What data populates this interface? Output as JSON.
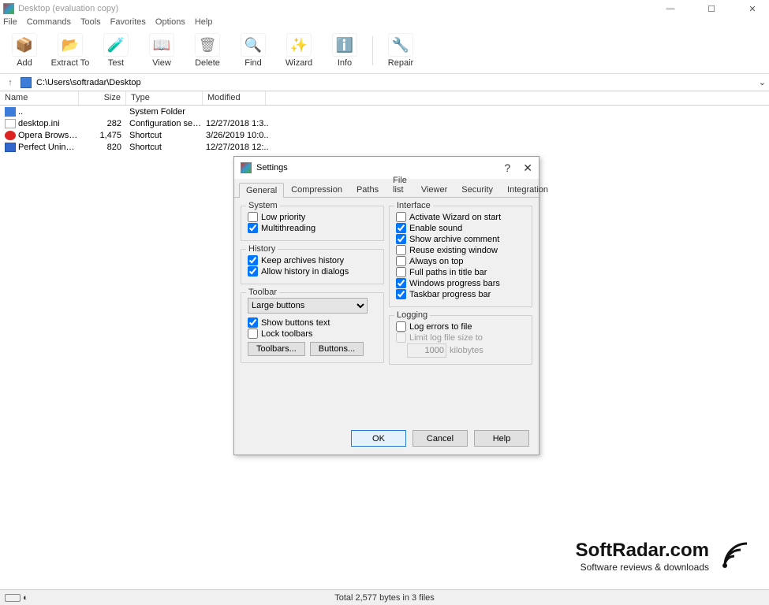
{
  "window": {
    "title": "Desktop (evaluation copy)"
  },
  "menu": [
    "File",
    "Commands",
    "Tools",
    "Favorites",
    "Options",
    "Help"
  ],
  "toolbar": [
    {
      "label": "Add",
      "icon": "📦",
      "color": "#c66"
    },
    {
      "label": "Extract To",
      "icon": "📂",
      "color": "#3a7bd5"
    },
    {
      "label": "Test",
      "icon": "🧪",
      "color": "#3ab54a"
    },
    {
      "label": "View",
      "icon": "📖",
      "color": "#b33"
    },
    {
      "label": "Delete",
      "icon": "🗑",
      "color": "#888"
    },
    {
      "label": "Find",
      "icon": "🔍",
      "color": "#d9902a"
    },
    {
      "label": "Wizard",
      "icon": "✨",
      "color": "#3ab54a"
    },
    {
      "label": "Info",
      "icon": "ℹ️",
      "color": "#2a7bd0"
    },
    {
      "label": "Repair",
      "icon": "🔧",
      "color": "#3a8a3a"
    }
  ],
  "path": "C:\\Users\\softradar\\Desktop",
  "columns": {
    "name": "Name",
    "size": "Size",
    "type": "Type",
    "modified": "Modified"
  },
  "files": [
    {
      "icon": "folder",
      "name": "..",
      "size": "",
      "type": "System Folder",
      "modified": ""
    },
    {
      "icon": "ini",
      "name": "desktop.ini",
      "size": "282",
      "type": "Configuration setti..",
      "modified": "12/27/2018 1:3.."
    },
    {
      "icon": "opera",
      "name": "Opera Browser.lnk",
      "size": "1,475",
      "type": "Shortcut",
      "modified": "3/26/2019 10:0.."
    },
    {
      "icon": "app",
      "name": "Perfect Uninstall...",
      "size": "820",
      "type": "Shortcut",
      "modified": "12/27/2018 12:.."
    }
  ],
  "settings": {
    "title": "Settings",
    "tabs": [
      "General",
      "Compression",
      "Paths",
      "File list",
      "Viewer",
      "Security",
      "Integration"
    ],
    "activeTab": 0,
    "system": {
      "legend": "System",
      "low_priority": "Low priority",
      "multithreading": "Multithreading"
    },
    "history": {
      "legend": "History",
      "keep": "Keep archives history",
      "allow": "Allow history in dialogs"
    },
    "toolbar": {
      "legend": "Toolbar",
      "select": "Large buttons",
      "show_text": "Show buttons text",
      "lock": "Lock toolbars",
      "btn_toolbars": "Toolbars...",
      "btn_buttons": "Buttons..."
    },
    "iface": {
      "legend": "Interface",
      "wizard": "Activate Wizard on start",
      "sound": "Enable sound",
      "comment": "Show archive comment",
      "reuse": "Reuse existing window",
      "ontop": "Always on top",
      "fullpath": "Full paths in title bar",
      "winprog": "Windows progress bars",
      "taskprog": "Taskbar progress bar"
    },
    "logging": {
      "legend": "Logging",
      "log": "Log errors to file",
      "limit": "Limit log file size to",
      "value": "1000",
      "unit": "kilobytes"
    },
    "buttons": {
      "ok": "OK",
      "cancel": "Cancel",
      "help": "Help"
    }
  },
  "status": "Total 2,577 bytes in 3 files",
  "watermark": {
    "brand": "SoftRadar.com",
    "sub": "Software reviews & downloads"
  }
}
